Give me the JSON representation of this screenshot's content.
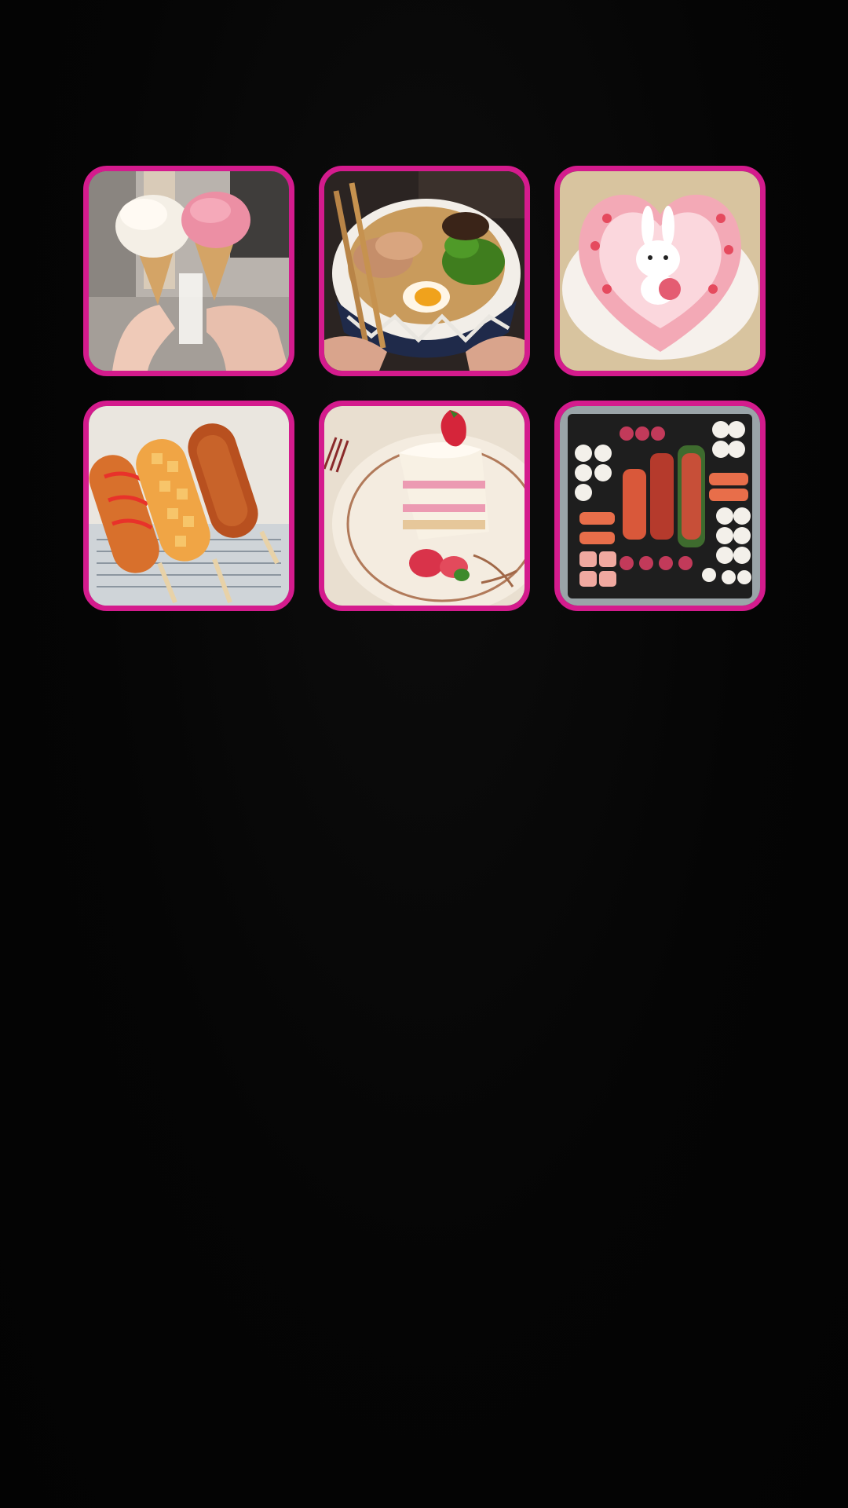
{
  "screen": {
    "background": "#050505",
    "accent": "#d41b8d"
  },
  "grid": {
    "tiles": [
      {
        "icon": "ice-cream-cones-photo"
      },
      {
        "icon": "ramen-bowl-photo"
      },
      {
        "icon": "pink-heart-cake-photo"
      },
      {
        "icon": "korean-corndogs-photo"
      },
      {
        "icon": "strawberry-shortcake-photo"
      },
      {
        "icon": "sushi-box-photo"
      }
    ]
  }
}
